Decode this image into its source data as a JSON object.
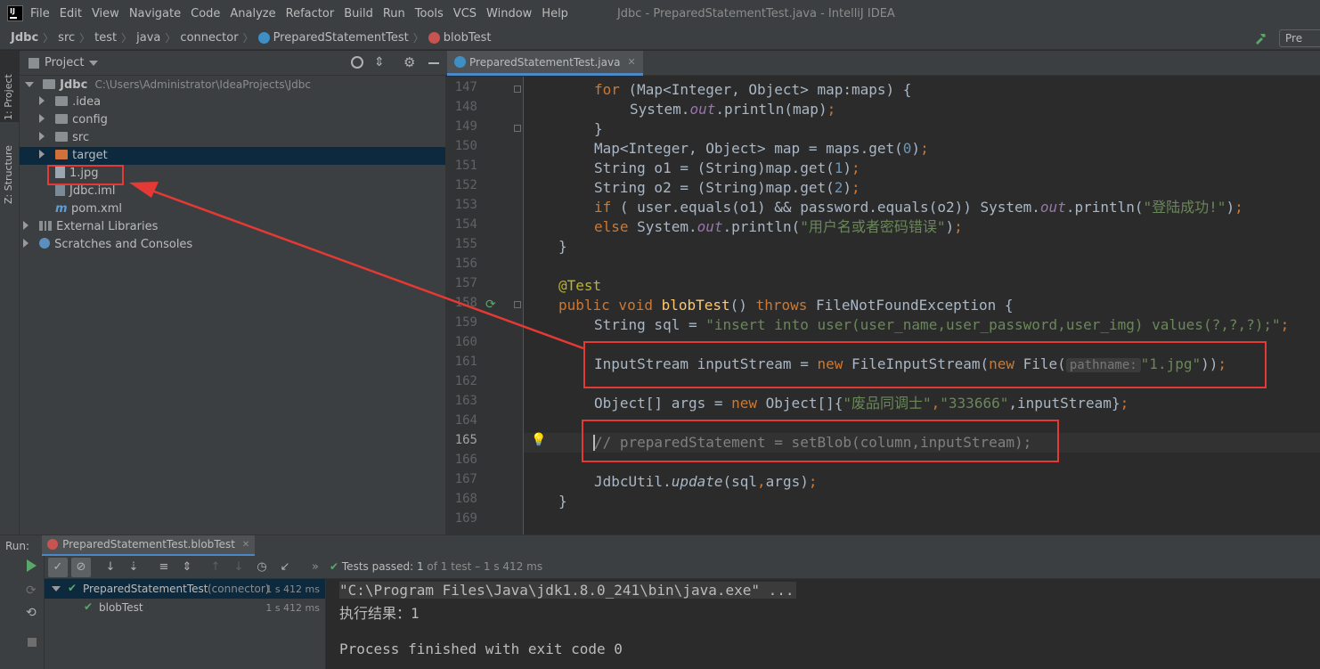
{
  "menubar": {
    "items": [
      "File",
      "Edit",
      "View",
      "Navigate",
      "Code",
      "Analyze",
      "Refactor",
      "Build",
      "Run",
      "Tools",
      "VCS",
      "Window",
      "Help"
    ],
    "window_title": "Jdbc - PreparedStatementTest.java - IntelliJ IDEA"
  },
  "breadcrumb": {
    "items": [
      "Jdbc",
      "src",
      "test",
      "java",
      "connector",
      "PreparedStatementTest",
      "blobTest"
    ],
    "run_config": "Pre"
  },
  "left_stripe": {
    "project_tab": "1: Project",
    "structure_tab": "Z: Structure"
  },
  "project": {
    "title": "Project",
    "root_name": "Jdbc",
    "root_path": "C:\\Users\\Administrator\\IdeaProjects\\Jdbc",
    "items": [
      ".idea",
      "config",
      "src",
      "target",
      "1.jpg",
      "Jdbc.iml",
      "pom.xml"
    ],
    "external_libraries": "External Libraries",
    "scratches": "Scratches and Consoles"
  },
  "editor": {
    "tab_title": "PreparedStatementTest.java",
    "line_numbers": [
      "147",
      "148",
      "149",
      "150",
      "151",
      "152",
      "153",
      "154",
      "155",
      "156",
      "157",
      "158",
      "159",
      "160",
      "161",
      "162",
      "163",
      "164",
      "165",
      "166",
      "167",
      "168",
      "169"
    ],
    "code": {
      "l147a": "for ",
      "l147b": "(Map<Integer, Object> map:maps) {",
      "l148a": "System.",
      "l148b": "out",
      "l148c": ".println(map)",
      "l148d": ";",
      "l149": "}",
      "l150a": "Map<Integer, Object> map = maps.get(",
      "l150b": "0",
      "l150c": ")",
      "l150d": ";",
      "l151a": "String o1 = (String)map.get(",
      "l151b": "1",
      "l151c": ")",
      "l151d": ";",
      "l152a": "String o2 = (String)map.get(",
      "l152b": "2",
      "l152c": ")",
      "l152d": ";",
      "l153a": "if ",
      "l153b": "( user.equals(o1) && password.equals(o2)) System.",
      "l153c": "out",
      "l153d": ".println(",
      "l153e": "\"登陆成功!\"",
      "l153f": ")",
      "l153g": ";",
      "l154a": "else ",
      "l154b": "System.",
      "l154c": "out",
      "l154d": ".println(",
      "l154e": "\"用户名或者密码错误\"",
      "l154f": ")",
      "l154g": ";",
      "l155": "}",
      "l157": "@Test",
      "l158a": "public void ",
      "l158b": "blobTest",
      "l158c": "() ",
      "l158d": "throws ",
      "l158e": "FileNotFoundException {",
      "l159a": "String sql = ",
      "l159b": "\"insert into user(user_name,user_password,user_img) values(?,?,?);\"",
      "l159c": ";",
      "l161a": "InputStream inputStream = ",
      "l161b": "new ",
      "l161c": "FileInputStream(",
      "l161d": "new ",
      "l161e": "File(",
      "l161hint": "pathname:",
      "l161f": "\"1.jpg\"",
      "l161g": "))",
      "l161h": ";",
      "l163a": "Object[] args = ",
      "l163b": "new ",
      "l163c": "Object[]{",
      "l163d": "\"废品同调士\"",
      "l163e": ",",
      "l163f": "\"333666\"",
      "l163g": ",inputStream}",
      "l163h": ";",
      "l165": "// preparedStatement = setBlob(column,inputStream);",
      "l167a": "JdbcUtil.",
      "l167b": "update",
      "l167c": "(sql",
      "l167d": ",",
      "l167e": "args)",
      "l167f": ";",
      "l168": "}"
    }
  },
  "run": {
    "label": "Run:",
    "tab_title": "PreparedStatementTest.blobTest",
    "tests_passed": "Tests passed:",
    "passed_count": "1",
    "passed_detail": "of 1 test – 1 s 412 ms",
    "tree": [
      {
        "name": "PreparedStatementTest",
        "sub": "(connector)",
        "time": "1 s 412 ms"
      },
      {
        "name": "blobTest",
        "sub": "",
        "time": "1 s 412 ms"
      }
    ],
    "console": [
      "\"C:\\Program Files\\Java\\jdk1.8.0_241\\bin\\java.exe\" ...",
      "执行结果：1",
      "",
      "Process finished with exit code 0"
    ]
  },
  "colors": {
    "accent_red": "#e53935",
    "pass_green": "#59a869",
    "tab_underline": "#4a88c7"
  }
}
